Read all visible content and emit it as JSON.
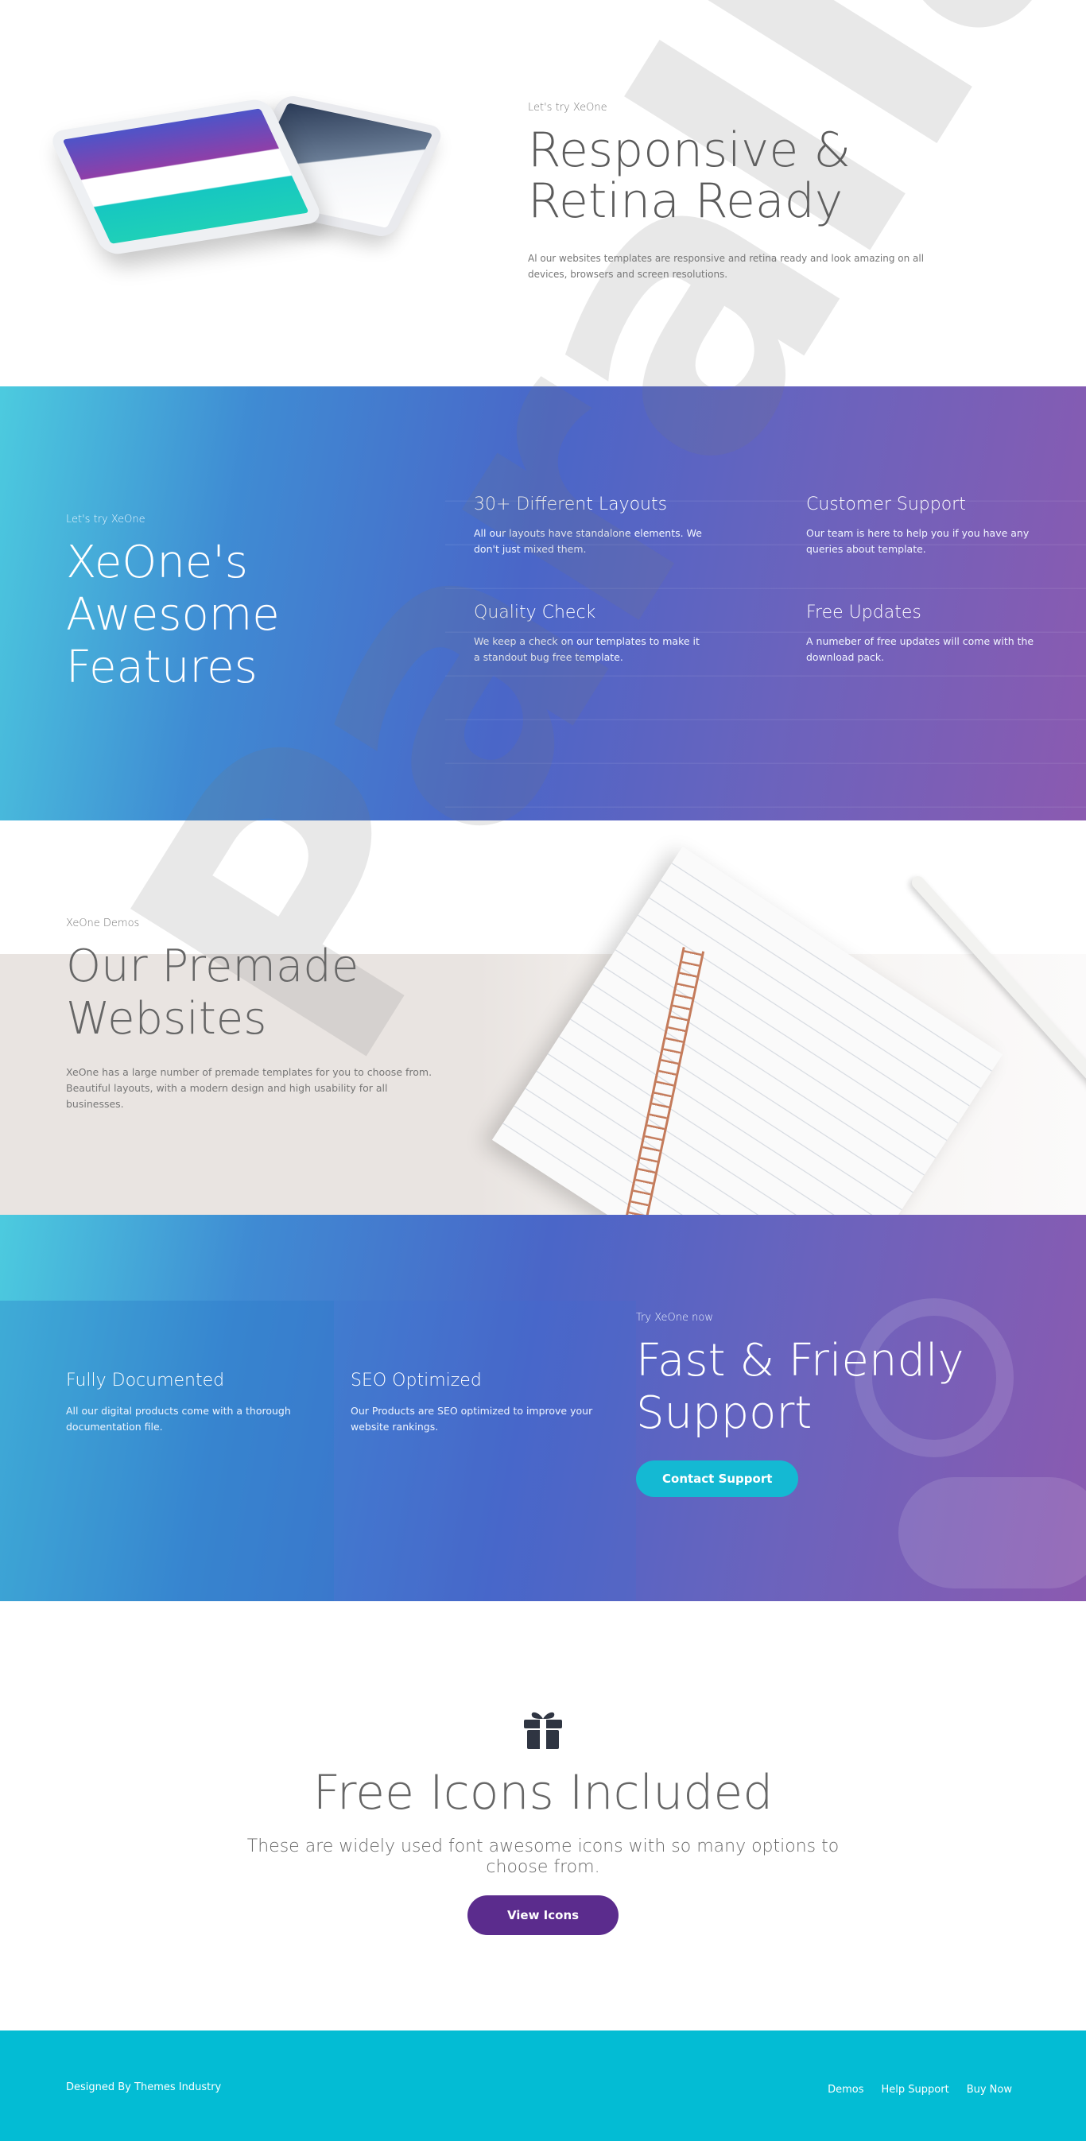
{
  "responsive": {
    "kicker": "Let's try XeOne",
    "title": "Responsive & Retina Ready",
    "desc": "Al our websites templates are responsive and retina ready and look amazing on all devices, browsers and screen resolutions."
  },
  "features": {
    "kicker": "Let's try XeOne",
    "title": "XeOne's Awesome Features",
    "items": [
      {
        "title": "30+ Different Layouts",
        "desc": "All our layouts have standalone elements. We don't just mixed them."
      },
      {
        "title": "Customer Support",
        "desc": "Our team is here to help you if you have any queries about template."
      },
      {
        "title": "Quality Check",
        "desc": "We keep a check on our templates to make it a standout bug free template."
      },
      {
        "title": "Free Updates",
        "desc": "A numeber of free updates will come with the download pack."
      }
    ]
  },
  "premade": {
    "kicker": "XeOne Demos",
    "title": "Our Premade Websites",
    "desc": "XeOne has a large number of premade templates for you to choose from. Beautiful layouts, with a modern design and high usability for all businesses."
  },
  "support": {
    "items": [
      {
        "title": "Fully Documented",
        "desc": "All our digital products come with a thorough documentation file."
      },
      {
        "title": "SEO Optimized",
        "desc": "Our Products are SEO optimized to improve your website rankings."
      }
    ],
    "kicker": "Try XeOne now",
    "title": "Fast & Friendly Support",
    "button": "Contact Support"
  },
  "icons": {
    "icon": "gift-icon",
    "title": "Free Icons Included",
    "desc": "These are widely used font awesome icons with so many options to choose from.",
    "button": "View Icons"
  },
  "footer": {
    "credit": "Designed By Themes Industry",
    "links": [
      "Demos",
      "Help Support",
      "Buy Now"
    ]
  },
  "watermark": "Parallax",
  "colors": {
    "accent_cyan": "#03bcd4",
    "button_purple": "#5b2c8d",
    "gradient_start": "#4ccbdf",
    "gradient_end": "#8b5ab0"
  }
}
